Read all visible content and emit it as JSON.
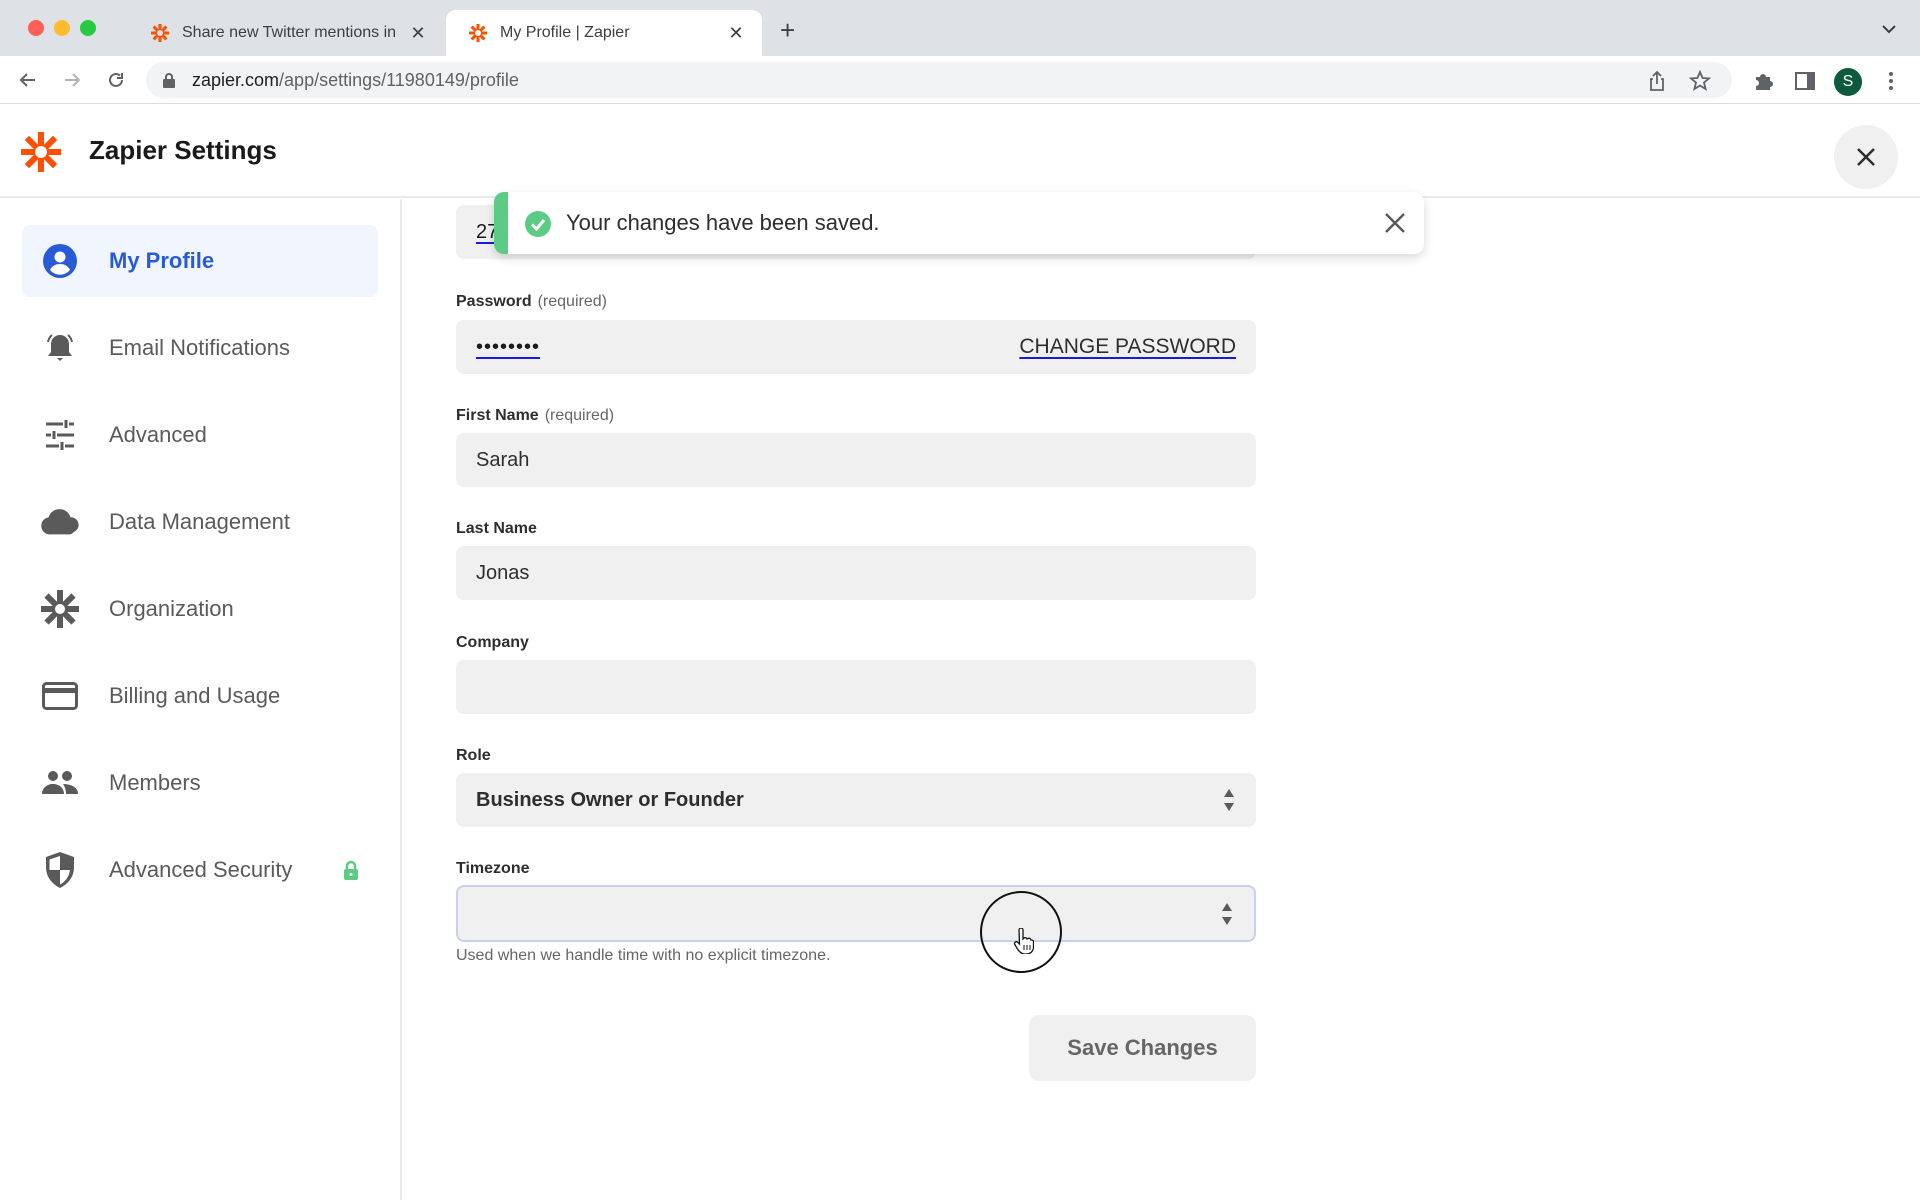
{
  "browser": {
    "tabs": [
      {
        "title": "Share new Twitter mentions in",
        "active": false,
        "icon": "zapier-favicon"
      },
      {
        "title": "My Profile | Zapier",
        "active": true,
        "icon": "zapier-favicon"
      }
    ],
    "url_host": "zapier.com",
    "url_path": "/app/settings/11980149/profile",
    "profile_initial": "S"
  },
  "header": {
    "title": "Zapier Settings"
  },
  "sidebar": {
    "items": [
      {
        "label": "My Profile",
        "icon": "user-circle-icon",
        "active": true
      },
      {
        "label": "Email Notifications",
        "icon": "bell-icon",
        "active": false
      },
      {
        "label": "Advanced",
        "icon": "sliders-icon",
        "active": false
      },
      {
        "label": "Data Management",
        "icon": "cloud-icon",
        "active": false
      },
      {
        "label": "Organization",
        "icon": "asterisk-icon",
        "active": false
      },
      {
        "label": "Billing and Usage",
        "icon": "credit-card-icon",
        "active": false
      },
      {
        "label": "Members",
        "icon": "people-icon",
        "active": false
      },
      {
        "label": "Advanced Security",
        "icon": "shield-icon",
        "active": false,
        "locked": true
      }
    ]
  },
  "toast": {
    "message": "Your changes have been saved.",
    "status_color": "#5ccc84"
  },
  "form": {
    "partial_field_value": "27",
    "password": {
      "label": "Password",
      "qualifier": "(required)",
      "value": "••••••••",
      "action": "CHANGE PASSWORD"
    },
    "first_name": {
      "label": "First Name",
      "qualifier": "(required)",
      "value": "Sarah"
    },
    "last_name": {
      "label": "Last Name",
      "value": "Jonas"
    },
    "company": {
      "label": "Company",
      "value": ""
    },
    "role": {
      "label": "Role",
      "value": "Business Owner or Founder"
    },
    "timezone": {
      "label": "Timezone",
      "value": "",
      "help": "Used when we handle time with no explicit timezone."
    },
    "save_label": "Save Changes"
  },
  "colors": {
    "brand": "#ff4f00",
    "active_nav": "#2a5bd7",
    "success": "#5ccc84"
  }
}
